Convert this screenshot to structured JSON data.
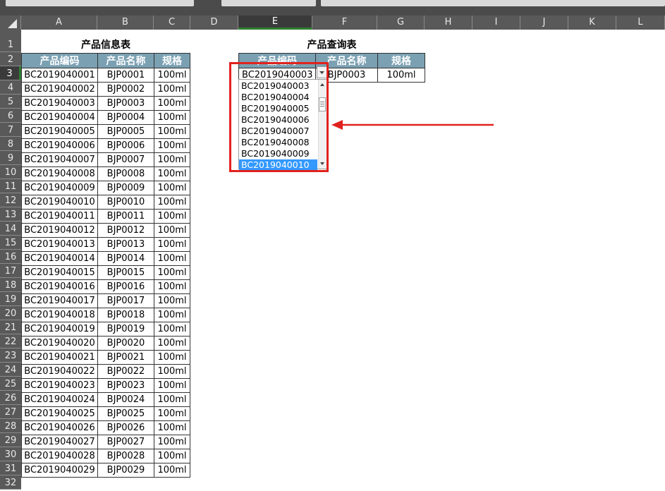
{
  "columns": [
    "A",
    "B",
    "C",
    "D",
    "E",
    "F",
    "G",
    "H",
    "I",
    "J",
    "K",
    "L"
  ],
  "rows": [
    "1",
    "2",
    "3",
    "4",
    "5",
    "6",
    "7",
    "8",
    "9",
    "10",
    "11",
    "12",
    "13",
    "14",
    "15",
    "16",
    "17",
    "18",
    "19",
    "20",
    "21",
    "22",
    "23",
    "24",
    "25",
    "26",
    "27",
    "28",
    "29",
    "30",
    "31",
    "32"
  ],
  "selected_column": "E",
  "selected_row": "3",
  "product_info": {
    "title": "产品信息表",
    "headers": [
      "产品编码",
      "产品名称",
      "规格"
    ],
    "rows": [
      [
        "BC2019040001",
        "BJP0001",
        "100ml"
      ],
      [
        "BC2019040002",
        "BJP0002",
        "100ml"
      ],
      [
        "BC2019040003",
        "BJP0003",
        "100ml"
      ],
      [
        "BC2019040004",
        "BJP0004",
        "100ml"
      ],
      [
        "BC2019040005",
        "BJP0005",
        "100ml"
      ],
      [
        "BC2019040006",
        "BJP0006",
        "100ml"
      ],
      [
        "BC2019040007",
        "BJP0007",
        "100ml"
      ],
      [
        "BC2019040008",
        "BJP0008",
        "100ml"
      ],
      [
        "BC2019040009",
        "BJP0009",
        "100ml"
      ],
      [
        "BC2019040010",
        "BJP0010",
        "100ml"
      ],
      [
        "BC2019040011",
        "BJP0011",
        "100ml"
      ],
      [
        "BC2019040012",
        "BJP0012",
        "100ml"
      ],
      [
        "BC2019040013",
        "BJP0013",
        "100ml"
      ],
      [
        "BC2019040014",
        "BJP0014",
        "100ml"
      ],
      [
        "BC2019040015",
        "BJP0015",
        "100ml"
      ],
      [
        "BC2019040016",
        "BJP0016",
        "100ml"
      ],
      [
        "BC2019040017",
        "BJP0017",
        "100ml"
      ],
      [
        "BC2019040018",
        "BJP0018",
        "100ml"
      ],
      [
        "BC2019040019",
        "BJP0019",
        "100ml"
      ],
      [
        "BC2019040020",
        "BJP0020",
        "100ml"
      ],
      [
        "BC2019040021",
        "BJP0021",
        "100ml"
      ],
      [
        "BC2019040022",
        "BJP0022",
        "100ml"
      ],
      [
        "BC2019040023",
        "BJP0023",
        "100ml"
      ],
      [
        "BC2019040024",
        "BJP0024",
        "100ml"
      ],
      [
        "BC2019040025",
        "BJP0025",
        "100ml"
      ],
      [
        "BC2019040026",
        "BJP0026",
        "100ml"
      ],
      [
        "BC2019040027",
        "BJP0027",
        "100ml"
      ],
      [
        "BC2019040028",
        "BJP0028",
        "100ml"
      ],
      [
        "BC2019040029",
        "BJP0029",
        "100ml"
      ]
    ]
  },
  "product_query": {
    "title": "产品查询表",
    "headers": [
      "产品编码",
      "产品名称",
      "规格"
    ],
    "row": [
      "BC2019040003",
      "BJP0003",
      "100ml"
    ]
  },
  "dropdown": {
    "items": [
      "BC2019040003",
      "BC2019040004",
      "BC2019040005",
      "BC2019040006",
      "BC2019040007",
      "BC2019040008",
      "BC2019040009",
      "BC2019040010"
    ],
    "highlighted": "BC2019040010",
    "scroll_up_icon": "up-arrow-icon",
    "scroll_down_icon": "down-arrow-icon",
    "button_icon": "dropdown-arrow-icon"
  },
  "colors": {
    "header_fill": "#7aa0b2",
    "highlight": "#3399ff",
    "annotation": "#e0221e",
    "selection": "#2e7d32"
  }
}
